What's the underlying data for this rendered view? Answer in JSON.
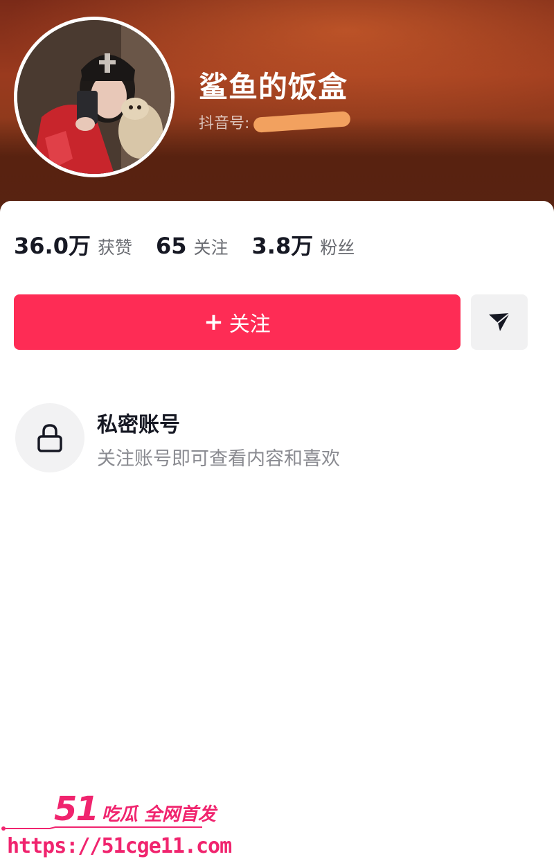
{
  "profile": {
    "name": "鲨鱼的饭盒",
    "douyin_id_label": "抖音号:"
  },
  "stats": [
    {
      "value": "36.0万",
      "label": "获赞"
    },
    {
      "value": "65",
      "label": "关注"
    },
    {
      "value": "3.8万",
      "label": "粉丝"
    }
  ],
  "actions": {
    "follow_label": "关注",
    "follow_icon": "plus-icon",
    "share_icon": "send-arrow-icon"
  },
  "private_account": {
    "icon": "lock-icon",
    "title": "私密账号",
    "description": "关注账号即可查看内容和喜欢"
  },
  "watermark": {
    "brand_number": "51",
    "brand_text": "吃瓜 全网首发",
    "url": "https://51cge11.com"
  },
  "colors": {
    "accent": "#fe2c55",
    "header": "#8e3a1c",
    "watermark": "#f0246e"
  }
}
